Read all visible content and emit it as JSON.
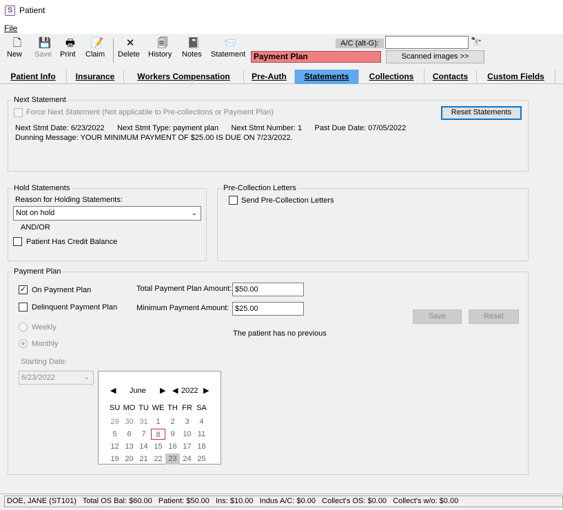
{
  "window": {
    "title": "Patient",
    "icon_letter": "S"
  },
  "menu": {
    "file": "File"
  },
  "toolbar": {
    "new": "New",
    "save": "Save",
    "print": "Print",
    "claim": "Claim",
    "delete": "Delete",
    "history": "History",
    "notes": "Notes",
    "statement": "Statement"
  },
  "account": {
    "label": "A/C (alt-G):",
    "value": ""
  },
  "banner": "Payment Plan",
  "scanned_images": "Scanned images >>",
  "tabs": [
    "Patient Info",
    "Insurance",
    "Workers Compensation",
    "Pre-Auth",
    "Statements",
    "Collections",
    "Contacts",
    "Custom Fields"
  ],
  "active_tab": "Statements",
  "next_statement": {
    "title": "Next Statement",
    "force_label": "Force Next Statement (Not applicable to Pre-collections or Payment Plan)",
    "reset_button": "Reset Statements",
    "info_line": "Next Stmt Date: 6/23/2022      Next Stmt Type: payment plan      Next Stmt Number: 1      Past Due Date: 07/05/2022",
    "dunning": "Dunning Message: YOUR MINIMUM PAYMENT OF $25.00 IS DUE ON 7/23/2022."
  },
  "hold": {
    "title": "Hold Statements",
    "reason_label": "Reason for Holding Statements:",
    "reason_value": "Not on hold",
    "andor": "AND/OR",
    "credit_label": "Patient Has Credit Balance"
  },
  "precollection": {
    "title": "Pre-Collection Letters",
    "send_label": "Send Pre-Collection Letters"
  },
  "payment_plan": {
    "title": "Payment Plan",
    "on_plan_label": "On Payment Plan",
    "on_plan_checked": true,
    "delinquent_label": "Delinquent Payment Plan",
    "weekly": "Weekly",
    "monthly": "Monthly",
    "starting_date_label": "Starting Date:",
    "starting_date_value": "6/23/2022",
    "total_label": "Total Payment Plan Amount:",
    "total_value": "$50.00",
    "minimum_label": "Minimum Payment Amount:",
    "minimum_value": "$25.00",
    "save": "Save",
    "reset": "Reset",
    "no_previous": "The patient has no previous"
  },
  "calendar": {
    "month": "June",
    "year": "2022",
    "dow": [
      "SU",
      "MO",
      "TU",
      "WE",
      "TH",
      "FR",
      "SA"
    ],
    "rows": [
      [
        "29",
        "30",
        "31",
        "1",
        "2",
        "3",
        "4"
      ],
      [
        "5",
        "6",
        "7",
        "8",
        "9",
        "10",
        "11"
      ],
      [
        "12",
        "13",
        "14",
        "15",
        "16",
        "17",
        "18"
      ],
      [
        "19",
        "20",
        "21",
        "22",
        "23",
        "24",
        "25"
      ]
    ],
    "today": "8",
    "selected": "23"
  },
  "status_bar": "DOE, JANE (ST101)   Total OS Bal: $60.00   Patient: $50.00   Ins: $10.00   Indus A/C: $0.00   Collect's OS: $0.00   Collect's w/o: $0.00"
}
